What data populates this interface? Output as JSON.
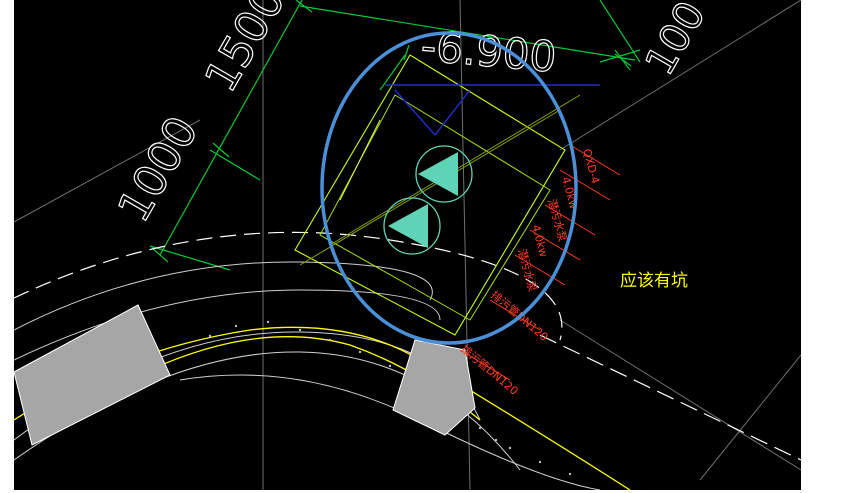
{
  "drawing": {
    "dimensions": {
      "dim_1500": "1500",
      "dim_1000": "1000",
      "dim_100": "100",
      "elevation": "-6.900"
    },
    "pump_labels": {
      "model": "QXD-4",
      "power_1": "4.0kw",
      "name_1": "潜污水泵",
      "power_2": "4.0kw",
      "name_2": "潜污水泵",
      "pipe_1": "排污管DN120",
      "pipe_2": "排污管DN120"
    },
    "annotation_note": "应该有坑"
  },
  "colors": {
    "background": "#000000",
    "dimension_green": "#00cc33",
    "outline_white": "#ffffff",
    "label_red": "#ff3b1f",
    "road_yellow": "#ffff00",
    "highlight_blue": "#4a90d9",
    "pump_fill": "#5fd3b5",
    "slab_gray": "#a6a6a6"
  }
}
